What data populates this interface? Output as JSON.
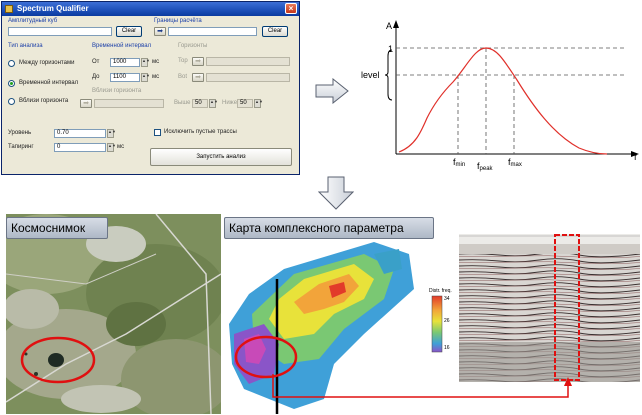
{
  "window": {
    "title": "Spectrum Qualifier",
    "close_glyph": "×",
    "cube_label": "Амплитудный куб",
    "bounds_label": "Границы расчёта",
    "clear_label": "Clear",
    "analysis_type_label": "Тип анализа",
    "time_interval_label": "Временной интервал",
    "horizons_label": "Горизонты",
    "radios": [
      {
        "label": "Между горизонтами",
        "selected": false
      },
      {
        "label": "Временной интервал",
        "selected": true
      },
      {
        "label": "Вблизи горизонта",
        "selected": false
      }
    ],
    "from_label": "От",
    "from_value": "1000",
    "to_label": "До",
    "to_value": "1100",
    "unit_ms": "мс",
    "top_label": "Top",
    "bot_label": "Bot",
    "near_horizon_label": "Вблизи горизонта",
    "above_label": "Выше",
    "below_label": "Ниже",
    "above_value": "50",
    "below_value": "50",
    "level_label": "Уровень",
    "level_value": "0.70",
    "taper_label": "Тапиринг",
    "taper_value": "0",
    "exclude_label": "Исключить пустые трассы",
    "run_label": "Запустить анализ"
  },
  "graph": {
    "y_axis_label": "A",
    "x_axis_label": "f",
    "one_label": "1",
    "level_label": "level",
    "fmin_label": "f",
    "fmin_sub": "min",
    "fpeak_label": "f",
    "fpeak_sub": "peak",
    "fmax_label": "f",
    "fmax_sub": "max",
    "curve_color": "#e0302a"
  },
  "panels": {
    "satellite_label": "Космоснимок",
    "map_label": "Карта комплексного параметра",
    "legend_title": "Distr. freq.",
    "legend_ticks": [
      "34",
      "26",
      "16"
    ]
  },
  "colors": {
    "accent_red": "#e01010",
    "title_blue": "#1c4fb8"
  }
}
